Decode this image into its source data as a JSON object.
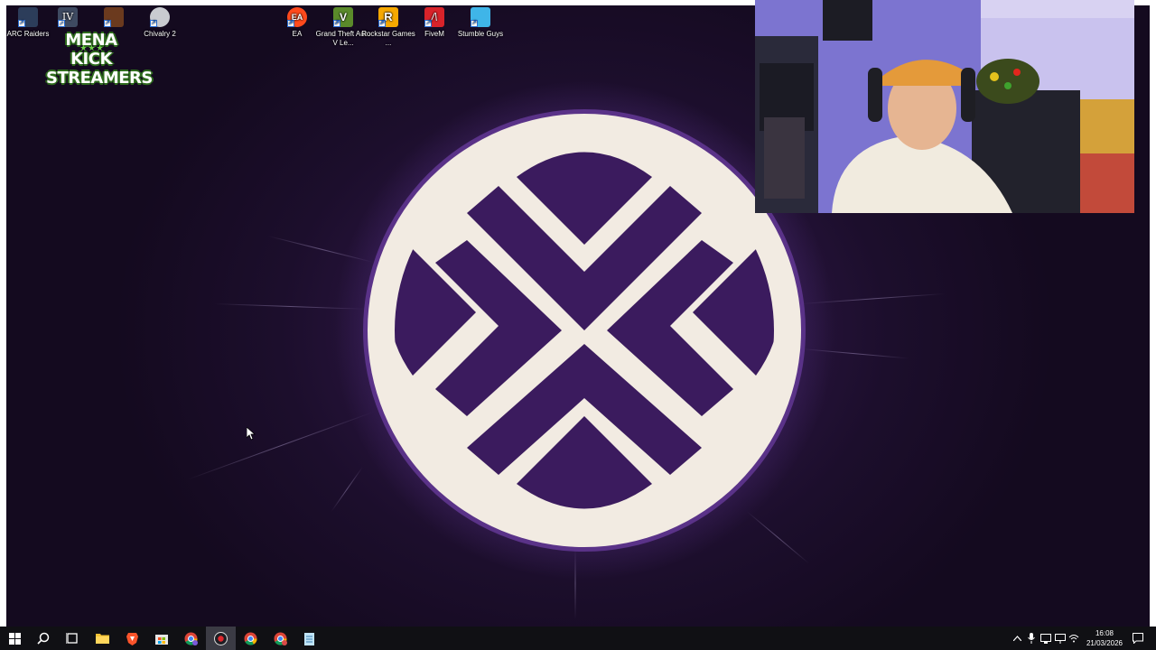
{
  "desktop": {
    "icons": [
      {
        "label": "ARC Raiders",
        "icon": "arc-raiders-icon",
        "color": "#2c3d5a"
      },
      {
        "label": "",
        "icon": "gta-iv-icon",
        "color": "#3e4a61"
      },
      {
        "label": "",
        "icon": "red-dead-icon",
        "color": "#6b3a1e"
      },
      {
        "label": "Chivalry 2",
        "icon": "chivalry-icon",
        "color": "#c9cbd0"
      },
      {
        "label": "EA",
        "icon": "ea-icon",
        "color": "#ff4a1c"
      },
      {
        "label": "Grand Theft Auto V Le...",
        "icon": "gta-v-icon",
        "color": "#5a8a2a"
      },
      {
        "label": "Rockstar Games ...",
        "icon": "rockstar-icon",
        "color": "#f6a800"
      },
      {
        "label": "FiveM",
        "icon": "fivem-icon",
        "color": "#d8232a"
      },
      {
        "label": "Stumble Guys",
        "icon": "stumble-guys-icon",
        "color": "#3fb5e8"
      }
    ],
    "overlay_logo": {
      "line1": "MENA KICK",
      "line2": "STREAMERS",
      "stars": "★★★"
    },
    "wallpaper_accent": "#3a1c5e",
    "logo_fill": "#f2ebe2",
    "logo_mark": "#3b1b5e"
  },
  "taskbar": {
    "buttons": [
      {
        "icon": "windows-start-icon"
      },
      {
        "icon": "search-icon"
      },
      {
        "icon": "task-view-icon"
      },
      {
        "icon": "file-explorer-icon"
      },
      {
        "icon": "brave-browser-icon"
      },
      {
        "icon": "microsoft-store-icon"
      },
      {
        "icon": "chrome-icon-1"
      },
      {
        "icon": "obs-record-icon"
      },
      {
        "icon": "chrome-icon-2"
      },
      {
        "icon": "chrome-icon-3"
      },
      {
        "icon": "notepad-icon"
      }
    ],
    "tray": [
      "chevron-up-icon",
      "microphone-icon",
      "network-icon",
      "display-icon",
      "wifi-icon",
      "volume-icon"
    ],
    "time": "16:08",
    "date": "21/03/2026"
  }
}
